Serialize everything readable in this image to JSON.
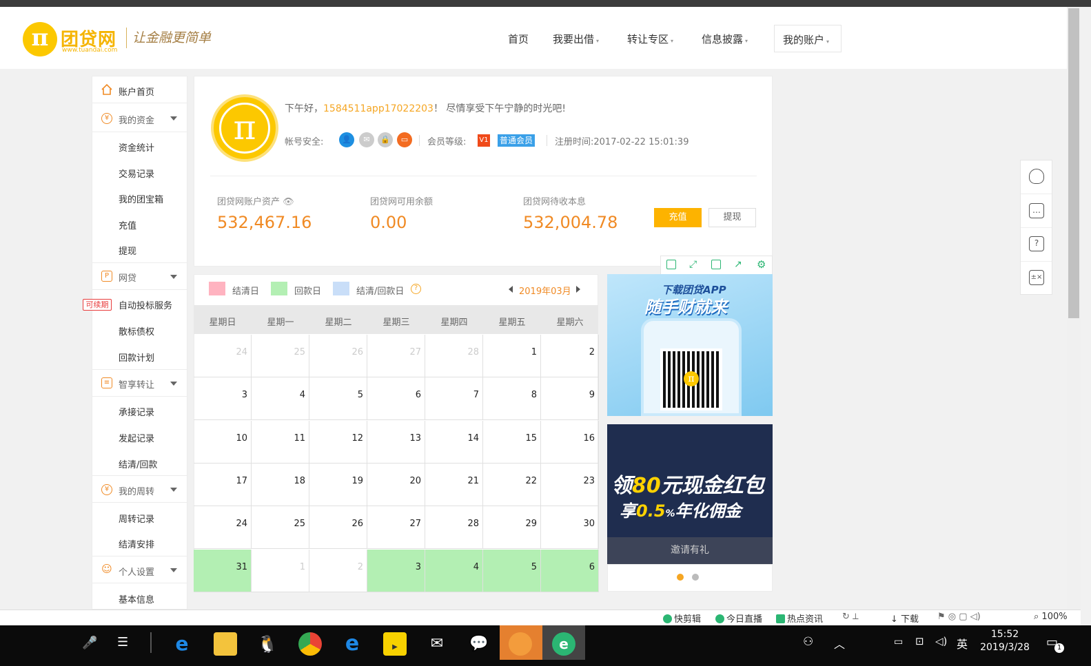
{
  "header": {
    "logo_symbol": "π",
    "logo_text": "团贷网",
    "logo_url": "www.tuandai.com",
    "slogan": "让金融更简单",
    "nav": [
      {
        "label": "首页",
        "arrow": ""
      },
      {
        "label": "我要出借",
        "arrow": "▾"
      },
      {
        "label": "转让专区",
        "arrow": "▾"
      },
      {
        "label": "信息披露",
        "arrow": "▾"
      },
      {
        "label": "我的账户",
        "arrow": "▾"
      }
    ]
  },
  "sidebar": {
    "home": "账户首页",
    "sections": [
      {
        "label": "我的资金",
        "icon": "yen-icon",
        "glyph": "¥",
        "items": [
          "资金统计",
          "交易记录",
          "我的团宝箱",
          "充值",
          "提现"
        ]
      },
      {
        "label": "网贷",
        "icon": "loan-icon",
        "glyph": "P",
        "items": [
          "自动投标服务",
          "散标债权",
          "回款计划"
        ]
      },
      {
        "label": "智享转让",
        "icon": "transfer-icon",
        "glyph": "≡",
        "items": [
          "承接记录",
          "发起记录",
          "结清/回款"
        ]
      },
      {
        "label": "我的周转",
        "icon": "turnover-icon",
        "glyph": "¥",
        "items": [
          "周转记录",
          "结清安排"
        ]
      },
      {
        "label": "个人设置",
        "icon": "user-icon",
        "glyph": "☺",
        "items": [
          "基本信息"
        ]
      }
    ],
    "renew_badge": "可续期"
  },
  "account": {
    "avatar_symbol": "π",
    "greeting_prefix": "下午好，",
    "username": "1584511app17022203",
    "greeting_suffix": "！ 尽情享受下午宁静的时光吧!",
    "security_label": "帐号安全:",
    "level_label": "会员等级:",
    "level_badge": "V1",
    "level_name": "普通会员",
    "register_label": "注册时间:",
    "register_time": "2017-02-22 15:01:39",
    "stats": [
      {
        "label": "团贷网账户资产",
        "value": "532,467.16"
      },
      {
        "label": "团贷网可用余额",
        "value": "0.00"
      },
      {
        "label": "团贷网待收本息",
        "value": "532,004.78"
      }
    ],
    "recharge_btn": "充值",
    "withdraw_btn": "提现"
  },
  "calendar": {
    "legend": [
      {
        "label": "结清日",
        "color": "#ffb3c0"
      },
      {
        "label": "回款日",
        "color": "#b3efb3"
      },
      {
        "label": "结清/回款日",
        "color": "#c9def8"
      }
    ],
    "help": "?",
    "month": "2019年03月",
    "weekdays": [
      "星期日",
      "星期一",
      "星期二",
      "星期三",
      "星期四",
      "星期五",
      "星期六"
    ],
    "weeks": [
      [
        {
          "d": "24",
          "dim": true
        },
        {
          "d": "25",
          "dim": true
        },
        {
          "d": "26",
          "dim": true
        },
        {
          "d": "27",
          "dim": true
        },
        {
          "d": "28",
          "dim": true
        },
        {
          "d": "1"
        },
        {
          "d": "2"
        }
      ],
      [
        {
          "d": "3"
        },
        {
          "d": "4"
        },
        {
          "d": "5"
        },
        {
          "d": "6"
        },
        {
          "d": "7"
        },
        {
          "d": "8"
        },
        {
          "d": "9"
        }
      ],
      [
        {
          "d": "10"
        },
        {
          "d": "11"
        },
        {
          "d": "12"
        },
        {
          "d": "13"
        },
        {
          "d": "14"
        },
        {
          "d": "15"
        },
        {
          "d": "16"
        }
      ],
      [
        {
          "d": "17"
        },
        {
          "d": "18"
        },
        {
          "d": "19"
        },
        {
          "d": "20"
        },
        {
          "d": "21"
        },
        {
          "d": "22"
        },
        {
          "d": "23"
        }
      ],
      [
        {
          "d": "24"
        },
        {
          "d": "25"
        },
        {
          "d": "26"
        },
        {
          "d": "27"
        },
        {
          "d": "28"
        },
        {
          "d": "29"
        },
        {
          "d": "30"
        }
      ],
      [
        {
          "d": "31",
          "green": true
        },
        {
          "d": "1",
          "dim": true
        },
        {
          "d": "2",
          "dim": true
        },
        {
          "d": "3",
          "green": true
        },
        {
          "d": "4",
          "green": true
        },
        {
          "d": "5",
          "green": true
        },
        {
          "d": "6",
          "green": true
        }
      ]
    ]
  },
  "ads": {
    "app_title": "下载团贷APP",
    "app_slogan": "随手财就来",
    "promo_line1_prefix": "领",
    "promo_line1_num": "80",
    "promo_line1_suffix": "元现金红包",
    "promo_line2_prefix": "享",
    "promo_line2_num": "0.5",
    "promo_line2_unit": "%",
    "promo_line2_suffix": "年化佣金",
    "invite": "邀请有礼"
  },
  "statusbar": [
    "快剪辑",
    "今日直播",
    "热点资讯",
    "下载",
    "100%"
  ],
  "taskbar": {
    "ime": "英",
    "time": "15:52",
    "date": "2019/3/28",
    "notif_count": "1"
  }
}
